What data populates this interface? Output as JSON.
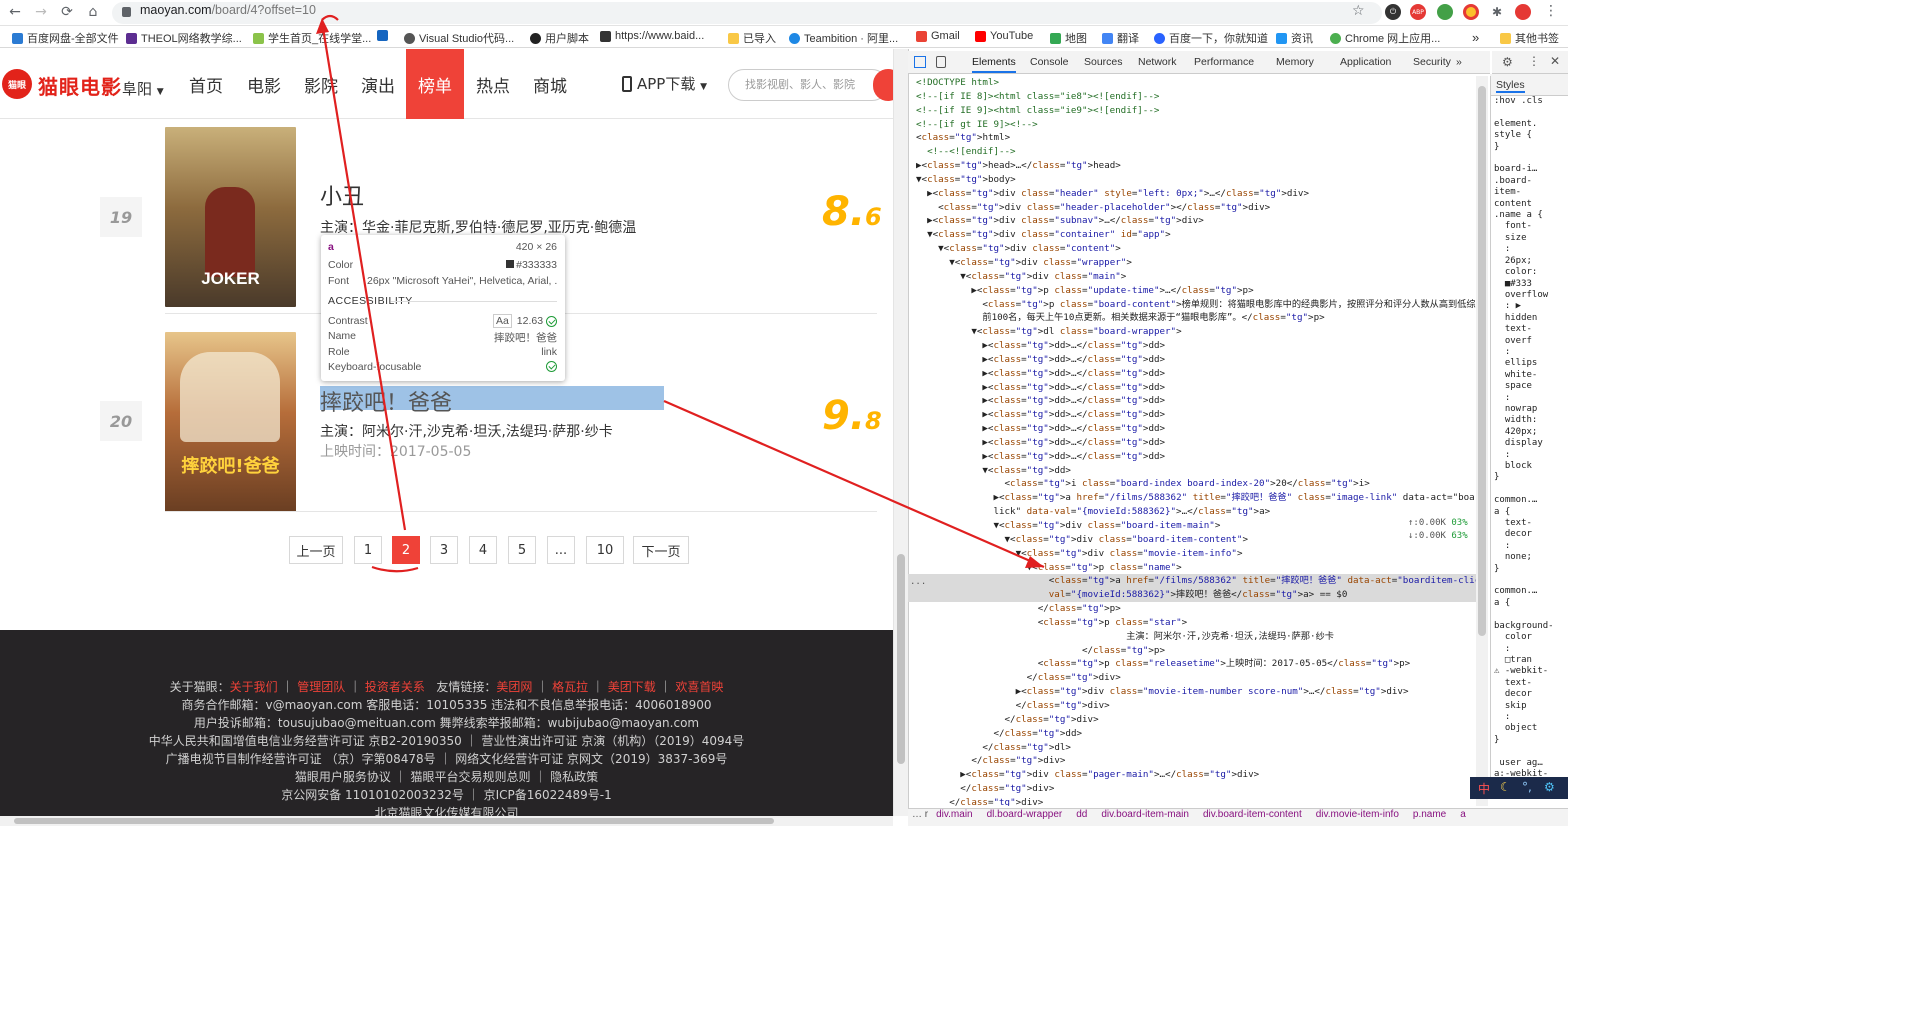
{
  "browser": {
    "url_host": "maoyan.com",
    "url_path": "/board/4?offset=10",
    "bookmarks": [
      "百度网盘-全部文件",
      "THEOL网络教学综...",
      "学生首页_在线学堂...",
      "Visual Studio代码...",
      "用户脚本",
      "https://www.baid...",
      "已导入",
      "Teambition · 阿里...",
      "Gmail",
      "YouTube",
      "地图",
      "翻译",
      "百度一下，你就知道",
      "资讯",
      "Chrome 网上应用...",
      "其他书签"
    ],
    "more_glyph": "»"
  },
  "site": {
    "brand": "猫眼电影",
    "logo_text": "猫眼",
    "city": "阜阳",
    "nav": [
      "首页",
      "电影",
      "影院",
      "演出",
      "榜单",
      "热点",
      "商城"
    ],
    "active_nav": "榜单",
    "app_download": "APP下载",
    "search_placeholder": "找影视剧、影人、影院"
  },
  "movies": [
    {
      "rank": "19",
      "name": "小丑",
      "stars": "主演：华金·菲尼克斯,罗伯特·德尼罗,亚历克·鲍德温",
      "release": "",
      "score_int": "8.",
      "score_frac": "6",
      "poster_text": "JOKER"
    },
    {
      "rank": "20",
      "name": "摔跤吧！爸爸",
      "stars": "主演：阿米尔·汗,沙克希·坦沃,法缇玛·萨那·纱卡",
      "release": "上映时间：2017-05-05",
      "score_int": "9.",
      "score_frac": "8",
      "poster_text": "摔跤吧!爸爸"
    }
  ],
  "tooltip": {
    "tag": "a",
    "size": "420 × 26",
    "color_label": "Color",
    "color_value": "#333333",
    "font_label": "Font",
    "font_value": "26px \"Microsoft YaHei\", Helvetica, Arial, ...",
    "accessibility": "ACCESSIBILITY",
    "contrast_label": "Contrast",
    "contrast_value": "12.63",
    "aa": "Aa",
    "name_label": "Name",
    "name_value": "摔跤吧！爸爸",
    "role_label": "Role",
    "role_value": "link",
    "keyboard_label": "Keyboard-focusable"
  },
  "pager": {
    "prev": "上一页",
    "pages": [
      "1",
      "2",
      "3",
      "4",
      "5",
      "...",
      "10"
    ],
    "active": "2",
    "next": "下一页"
  },
  "footer": {
    "line1_prefix": "关于猫眼：",
    "line1_links": [
      "关于我们",
      "管理团队",
      "投资者关系"
    ],
    "line1_friend": "友情链接：",
    "line1_friend_links": [
      "美团网",
      "格瓦拉",
      "美团下载",
      "欢喜首映"
    ],
    "line2": "商务合作邮箱：v@maoyan.com 客服电话：10105335 违法和不良信息举报电话：4006018900",
    "line3": "用户投诉邮箱：tousujubao@meituan.com 舞弊线索举报邮箱：wubijubao@maoyan.com",
    "line4": "中华人民共和国增值电信业务经营许可证 京B2-20190350 ｜ 营业性演出许可证 京演（机构）（2019）4094号",
    "line5": "广播电视节目制作经营许可证 （京）字第08478号 ｜ 网络文化经营许可证 京网文（2019）3837-369号",
    "line6": "猫眼用户服务协议 ｜ 猫眼平台交易规则总则 ｜ 隐私政策",
    "line7": "京公网安备 11010102003232号 ｜ 京ICP备16022489号-1",
    "line8": "北京猫眼文化传媒有限公司"
  },
  "devtools": {
    "tabs": [
      "Elements",
      "Console",
      "Sources",
      "Network",
      "Performance",
      "Memory",
      "Application",
      "Security"
    ],
    "active_tab": "Elements",
    "styles_tab": "Styles",
    "code_lines": [
      "<!DOCTYPE html>",
      "<!--[if IE 8]><html class=\"ie8\"><![endif]-->",
      "<!--[if IE 9]><html class=\"ie9\"><![endif]-->",
      "<!--[if gt IE 9]><!-->",
      "<html>",
      "  <!--<![endif]-->",
      "▶<head>…</head>",
      "▼<body>",
      "  ▶<div class=\"header\" style=\"left: 0px;\">…</div>",
      "    <div class=\"header-placeholder\"></div>",
      "  ▶<div class=\"subnav\">…</div>",
      "  ▼<div class=\"container\" id=\"app\">",
      "    ▼<div class=\"content\">",
      "      ▼<div class=\"wrapper\">",
      "        ▼<div class=\"main\">",
      "          ▶<p class=\"update-time\">…</p>",
      "            <p class=\"board-content\">榜单规则：将猫眼电影库中的经典影片，按照评分和评分人数从高到低综合排序取",
      "            前100名，每天上午10点更新。相关数据来源于“猫眼电影库”。</p>",
      "          ▼<dl class=\"board-wrapper\">",
      "            ▶<dd>…</dd>",
      "            ▶<dd>…</dd>",
      "            ▶<dd>…</dd>",
      "            ▶<dd>…</dd>",
      "            ▶<dd>…</dd>",
      "            ▶<dd>…</dd>",
      "            ▶<dd>…</dd>",
      "            ▶<dd>…</dd>",
      "            ▶<dd>…</dd>",
      "            ▼<dd>",
      "                <i class=\"board-index board-index-20\">20</i>",
      "              ▶<a href=\"/films/588362\" title=\"摔跤吧！爸爸\" class=\"image-link\" data-act=\"boarditem-c",
      "              lick\" data-val=\"{movieId:588362}\">…</a>",
      "              ▼<div class=\"board-item-main\">",
      "                ▼<div class=\"board-item-content\">",
      "                  ▼<div class=\"movie-item-info\">",
      "                    ▼<p class=\"name\">",
      "                        <a href=\"/films/588362\" title=\"摔跤吧！爸爸\" data-act=\"boarditem-click\" data-",
      "                        val=\"{movieId:588362}\">摔跤吧！爸爸</a> == $0",
      "                      </p>",
      "                      <p class=\"star\">",
      "                                      主演：阿米尔·汗,沙克希·坦沃,法缇玛·萨那·纱卡",
      "                              </p>",
      "                      <p class=\"releasetime\">上映时间：2017-05-05</p>",
      "                    </div>",
      "                  ▶<div class=\"movie-item-number score-num\">…</div>",
      "                  </div>",
      "                </div>",
      "              </dd>",
      "            </dl>",
      "          </div>",
      "        ▶<div class=\"pager-main\">…</div>",
      "        </div>",
      "      </div>"
    ],
    "network_up": "↑:0.00K",
    "network_up_pct": "03%",
    "network_down": "↓:0.00K",
    "network_down_pct": "63%",
    "breadcrumbs": [
      "div.main",
      "dl.board-wrapper",
      "dd",
      "div.board-item-main",
      "div.board-item-content",
      "div.movie-item-info",
      "p.name",
      "a"
    ],
    "styles_text": ":hov .cls\n\nelement.\nstyle {\n}\n\nboard-i…\n.board-\nitem-\ncontent\n.name a {\n  font-\n  size\n  :\n  26px;\n  color:\n  ■#333\n  overflow\n  : ▶\n  hidden\n  text-\n  overf\n  :\n  ellips\n  white-\n  space\n  :\n  nowrap\n  width:\n  420px;\n  display\n  :\n  block\n}\n\ncommon.…\na {\n  text-\n  decor\n  :\n  none;\n}\n\ncommon.…\na {\n\nbackground-\n  color\n  :\n  □tran\n⚠ -webkit-\n  text-\n  decor\n  skip\n  :\n  object\n}\n\n user ag…\na:-webkit-\nany-link {"
  }
}
